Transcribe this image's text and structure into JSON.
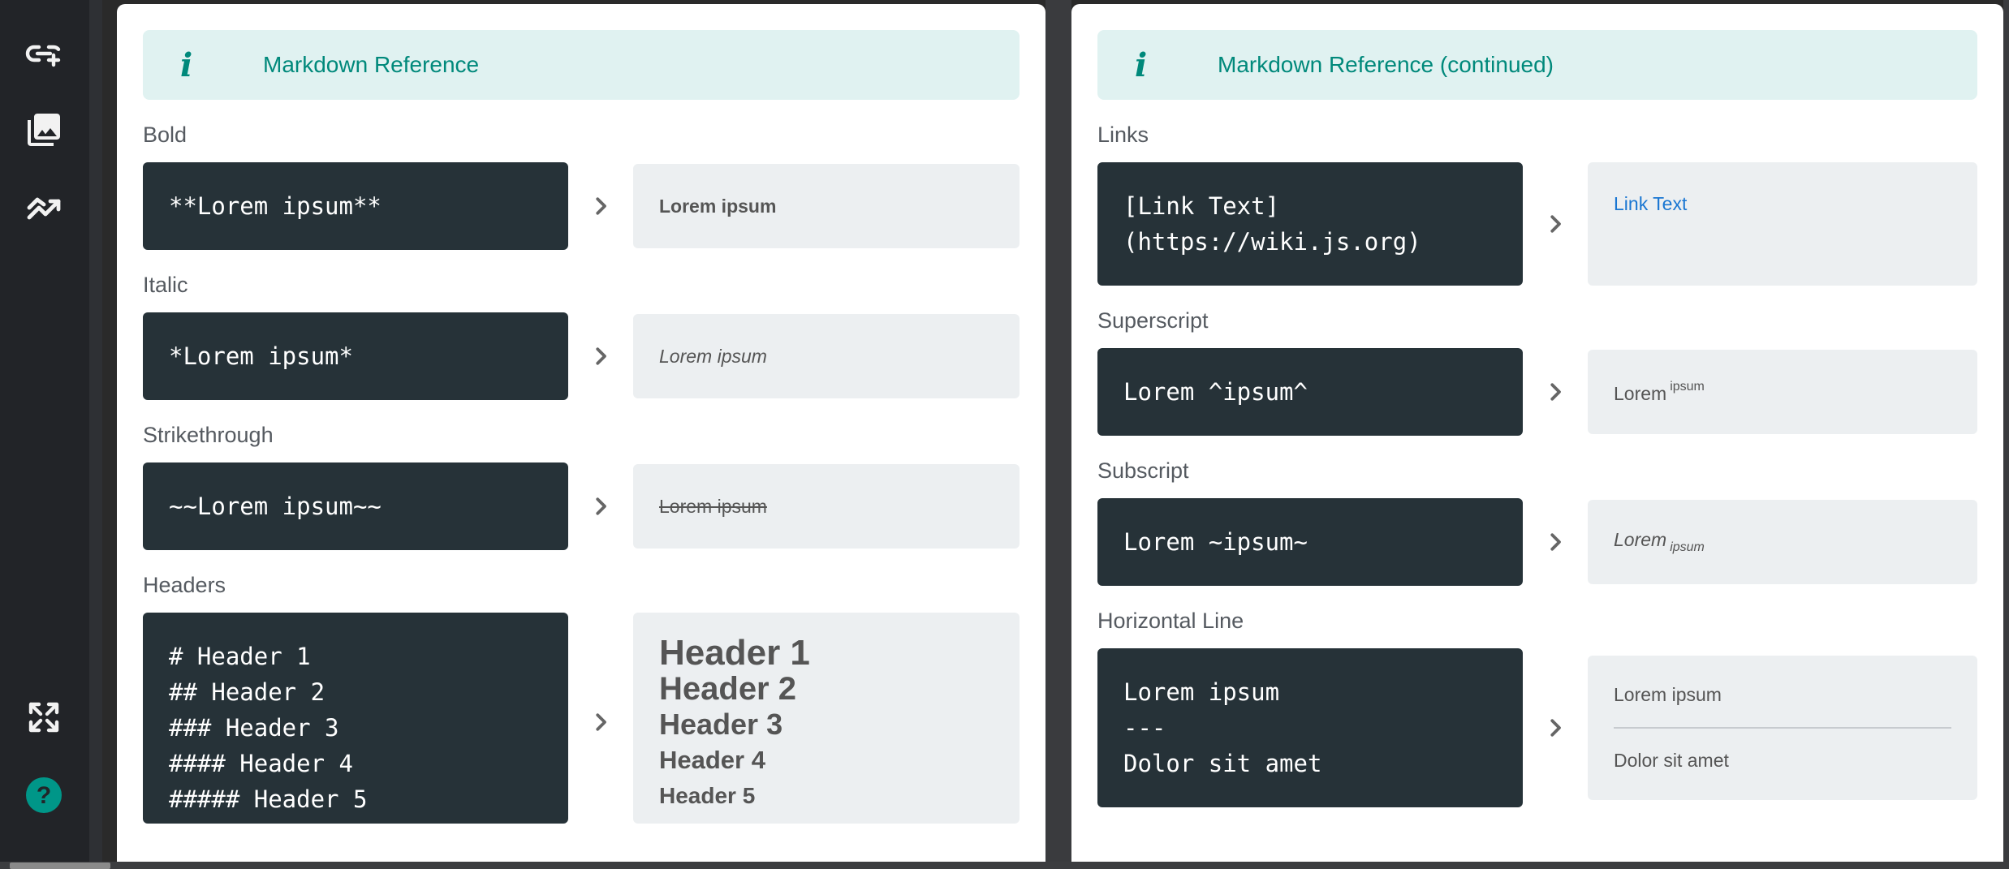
{
  "left": {
    "banner": {
      "icon": "i",
      "title": "Markdown Reference"
    },
    "sections": {
      "bold": {
        "label": "Bold",
        "code": "**Lorem ipsum**",
        "result": "Lorem ipsum"
      },
      "italic": {
        "label": "Italic",
        "code": "*Lorem ipsum*",
        "result": "Lorem ipsum"
      },
      "strike": {
        "label": "Strikethrough",
        "code": "~~Lorem ipsum~~",
        "result": "Lorem ipsum"
      },
      "headers": {
        "label": "Headers",
        "code": "# Header 1\n## Header 2\n### Header 3\n#### Header 4\n##### Header 5",
        "h1": "Header 1",
        "h2": "Header 2",
        "h3": "Header 3",
        "h4": "Header 4",
        "h5": "Header 5"
      }
    }
  },
  "right": {
    "banner": {
      "icon": "i",
      "title": "Markdown Reference (continued)"
    },
    "sections": {
      "links": {
        "label": "Links",
        "code": "[Link Text]\n(https://wiki.js.org)",
        "result": "Link Text"
      },
      "superscript": {
        "label": "Superscript",
        "code": "Lorem ^ipsum^",
        "result_main": "Lorem",
        "result_small": "ipsum"
      },
      "subscript": {
        "label": "Subscript",
        "code": "Lorem ~ipsum~",
        "result_main": "Lorem",
        "result_small": "ipsum"
      },
      "hr": {
        "label": "Horizontal Line",
        "code": "Lorem ipsum\n---\nDolor sit amet",
        "result_top": "Lorem ipsum",
        "result_bottom": "Dolor sit amet"
      }
    }
  },
  "sidebar": {
    "icons": [
      "link-plus-icon",
      "image-gallery-icon",
      "trend-chart-icon",
      "fullscreen-icon",
      "help-icon"
    ]
  }
}
